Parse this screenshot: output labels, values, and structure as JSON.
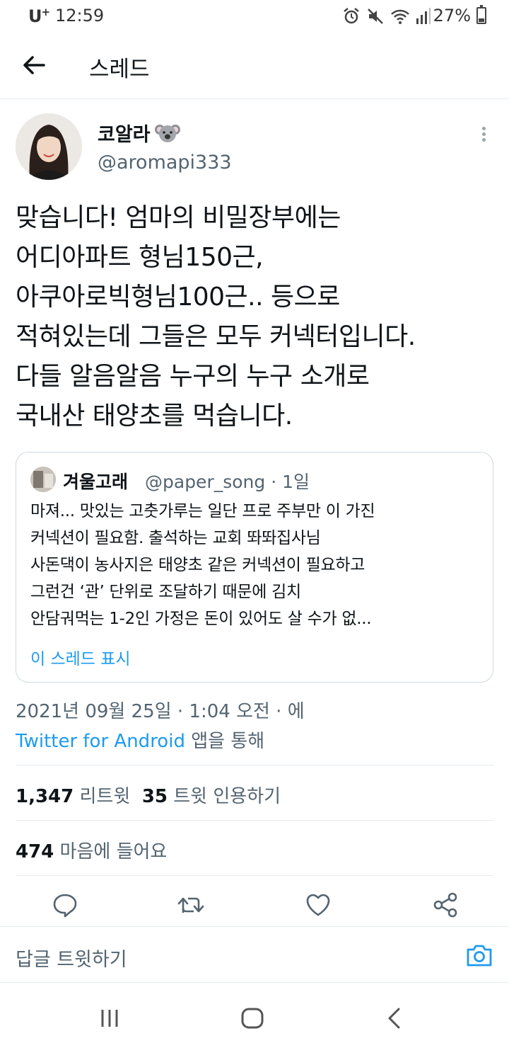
{
  "status_bar": {
    "carrier": "U",
    "carrier_sup": "+",
    "time": "12:59",
    "battery": "27%",
    "battery_level": 0.27,
    "icons": [
      "alarm-icon",
      "mute-icon",
      "wifi-icon",
      "signal-icon"
    ]
  },
  "header": {
    "title": "스레드",
    "back_icon": "arrow-left-icon"
  },
  "tweet": {
    "author_name": "코알라",
    "author_emoji": "koala-emoji",
    "author_handle": "@aromapi333",
    "text": "맞습니다! 엄마의 비밀장부에는\n어디아파트 형님150근,\n아쿠아로빅형님100근.. 등으로\n적혀있는데 그들은 모두 커넥터입니다.\n다들 알음알음 누구의 누구 소개로\n국내산 태양초를 먹습니다.",
    "date": "2021년 09월 25일 · 1:04 오전 · 에",
    "source_app": "Twitter for Android",
    "source_suffix": " 앱을 통해",
    "retweets_count": "1,347",
    "retweets_label": " 리트윗  ",
    "quotes_count": "35",
    "quotes_label": " 트윗 인용하기",
    "likes_count": "474",
    "likes_label": " 마음에 들어요"
  },
  "quote": {
    "author_name": "겨울고래",
    "author_handle": "@paper_song · 1일",
    "text": "마져... 맛있는 고춧가루는 일단 프로 주부만 이 가진\n커넥션이 필요함. 출석하는 교회 똬똬집사님\n사돈댁이 농사지은 태양초 같은 커넥션이 필요하고\n그런건 ‘관’ 단위로 조달하기 때문에 김치\n안담궈먹는 1-2인 가정은 돈이 있어도 살 수가 없...",
    "show_thread": "이 스레드 표시"
  },
  "actions": [
    "reply-icon",
    "retweet-icon",
    "like-icon",
    "share-icon"
  ],
  "reply_bar": {
    "placeholder": "답글 트윗하기",
    "camera_icon": "camera-icon"
  },
  "colors": {
    "accent": "#1d9bf0",
    "text": "#0f1419",
    "secondary": "#536471",
    "border": "#e6ecf0"
  }
}
